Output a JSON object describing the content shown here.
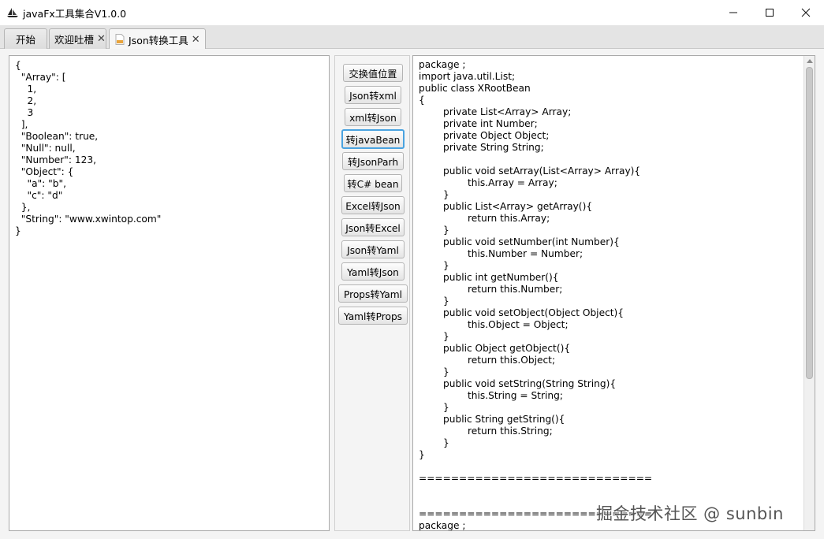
{
  "window": {
    "title": "javaFx工具集合V1.0.0",
    "app_icon": "sailboat-icon",
    "controls": [
      "minimize-icon",
      "maximize-icon",
      "close-icon"
    ]
  },
  "tabs": [
    {
      "label": "开始",
      "closable": false,
      "active": false
    },
    {
      "label": "欢迎吐槽",
      "closable": true,
      "active": false,
      "close_glyph": "✕"
    },
    {
      "label": "Json转换工具",
      "closable": true,
      "active": true,
      "close_glyph": "✕",
      "icon": "json-file-icon"
    }
  ],
  "input_text": "{\n  \"Array\": [\n    1,\n    2,\n    3\n  ],\n  \"Boolean\": true,\n  \"Null\": null,\n  \"Number\": 123,\n  \"Object\": {\n    \"a\": \"b\",\n    \"c\": \"d\"\n  },\n  \"String\": \"www.xwintop.com\"\n}",
  "buttons": [
    {
      "id": "swap",
      "label": "交换值位置"
    },
    {
      "id": "json-to-xml",
      "label": "Json转xml"
    },
    {
      "id": "xml-to-json",
      "label": "xml转Json"
    },
    {
      "id": "to-javabean",
      "label": "转javaBean",
      "focused": true
    },
    {
      "id": "to-jsonpath",
      "label": "转JsonParh"
    },
    {
      "id": "to-csharp-bean",
      "label": "转C# bean"
    },
    {
      "id": "excel-to-json",
      "label": "Excel转Json"
    },
    {
      "id": "json-to-excel",
      "label": "Json转Excel"
    },
    {
      "id": "json-to-yaml",
      "label": "Json转Yaml"
    },
    {
      "id": "yaml-to-json",
      "label": "Yaml转Json"
    },
    {
      "id": "props-to-yaml",
      "label": "Props转Yaml"
    },
    {
      "id": "yaml-to-props",
      "label": "Yaml转Props"
    }
  ],
  "output_text": "package ;\nimport java.util.List;\npublic class XRootBean\n{\n\tprivate List<Array> Array;\n\tprivate int Number;\n\tprivate Object Object;\n\tprivate String String;\n\n\tpublic void setArray(List<Array> Array){\n\t\tthis.Array = Array;\n\t}\n\tpublic List<Array> getArray(){\n\t\treturn this.Array;\n\t}\n\tpublic void setNumber(int Number){\n\t\tthis.Number = Number;\n\t}\n\tpublic int getNumber(){\n\t\treturn this.Number;\n\t}\n\tpublic void setObject(Object Object){\n\t\tthis.Object = Object;\n\t}\n\tpublic Object getObject(){\n\t\treturn this.Object;\n\t}\n\tpublic void setString(String String){\n\t\tthis.String = String;\n\t}\n\tpublic String getString(){\n\t\treturn this.String;\n\t}\n}\n\n=============================\n\n\n=============================\npackage ;",
  "watermark": "掘金技术社区 @ sunbin"
}
